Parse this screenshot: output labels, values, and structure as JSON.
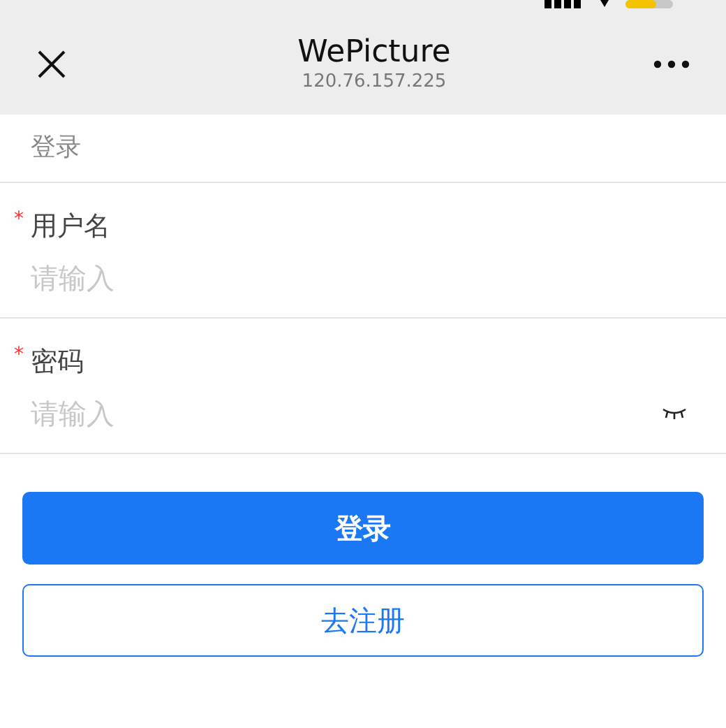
{
  "nav": {
    "title": "WePicture",
    "subtitle": "120.76.157.225"
  },
  "section_title": "登录",
  "fields": [
    {
      "kind": "text",
      "label": "用户名",
      "required_mark": "*",
      "placeholder": "请输入"
    },
    {
      "kind": "password",
      "label": "密码",
      "required_mark": "*",
      "placeholder": "请输入"
    }
  ],
  "buttons": [
    {
      "label": "登录",
      "kind": "primary"
    },
    {
      "label": "去注册",
      "kind": "outline"
    }
  ]
}
